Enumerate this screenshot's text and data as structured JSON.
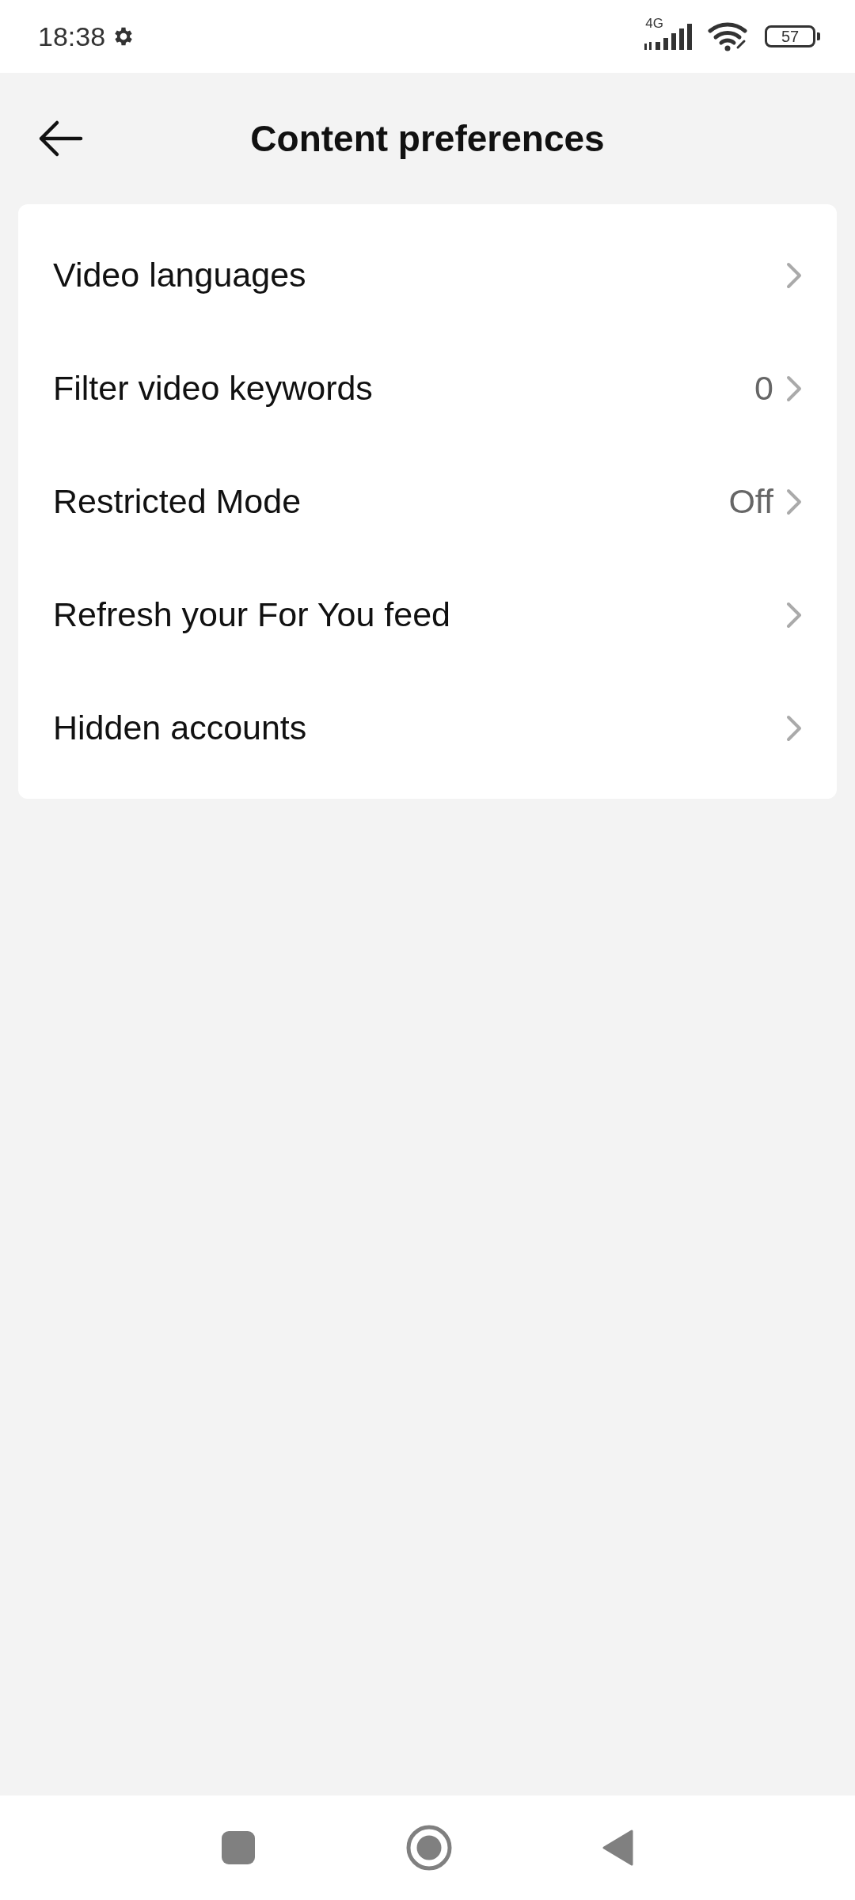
{
  "status_bar": {
    "time": "18:38",
    "network": "4G",
    "battery": "57"
  },
  "header": {
    "title": "Content preferences"
  },
  "items": [
    {
      "label": "Video languages"
    },
    {
      "label": "Filter video keywords",
      "value": "0"
    },
    {
      "label": "Restricted Mode",
      "value": "Off"
    },
    {
      "label": "Refresh your For You feed"
    },
    {
      "label": "Hidden accounts"
    }
  ]
}
